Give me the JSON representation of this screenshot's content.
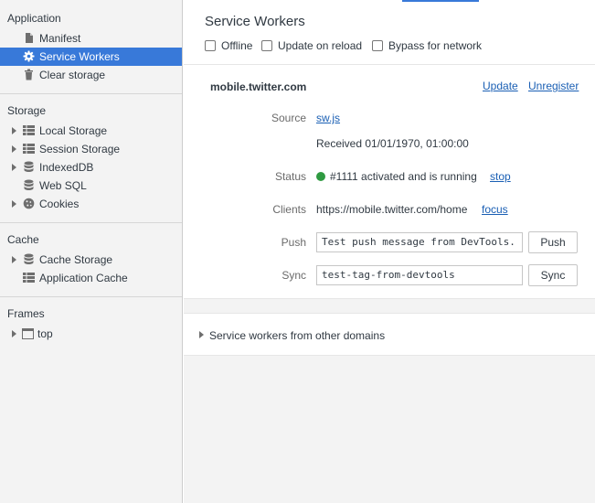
{
  "sidebar": {
    "application": {
      "title": "Application",
      "items": [
        {
          "label": "Manifest",
          "icon": "document-icon"
        },
        {
          "label": "Service Workers",
          "icon": "gear-icon"
        },
        {
          "label": "Clear storage",
          "icon": "trash-icon"
        }
      ]
    },
    "storage": {
      "title": "Storage",
      "items": [
        {
          "label": "Local Storage",
          "icon": "grid-icon"
        },
        {
          "label": "Session Storage",
          "icon": "grid-icon"
        },
        {
          "label": "IndexedDB",
          "icon": "database-icon"
        },
        {
          "label": "Web SQL",
          "icon": "database-icon"
        },
        {
          "label": "Cookies",
          "icon": "cookie-icon"
        }
      ]
    },
    "cache": {
      "title": "Cache",
      "items": [
        {
          "label": "Cache Storage",
          "icon": "database-icon"
        },
        {
          "label": "Application Cache",
          "icon": "grid-icon"
        }
      ]
    },
    "frames": {
      "title": "Frames",
      "items": [
        {
          "label": "top",
          "icon": "window-icon"
        }
      ]
    }
  },
  "main": {
    "title": "Service Workers",
    "options": {
      "offline": "Offline",
      "update_on_reload": "Update on reload",
      "bypass_for_network": "Bypass for network"
    },
    "worker": {
      "origin": "mobile.twitter.com",
      "update_link": "Update",
      "unregister_link": "Unregister",
      "source_label": "Source",
      "source_link": "sw.js",
      "received": "Received 01/01/1970, 01:00:00",
      "status_label": "Status",
      "status_text": "#1111 activated and is running",
      "stop_link": "stop",
      "clients_label": "Clients",
      "clients_url": "https://mobile.twitter.com/home",
      "focus_link": "focus",
      "push_label": "Push",
      "push_value": "Test push message from DevTools.",
      "push_button": "Push",
      "sync_label": "Sync",
      "sync_value": "test-tag-from-devtools",
      "sync_button": "Sync"
    },
    "other_domains": "Service workers from other domains"
  },
  "colors": {
    "selection": "#3879d9",
    "link": "#1a5fb4",
    "status_running": "#2f9a41"
  }
}
